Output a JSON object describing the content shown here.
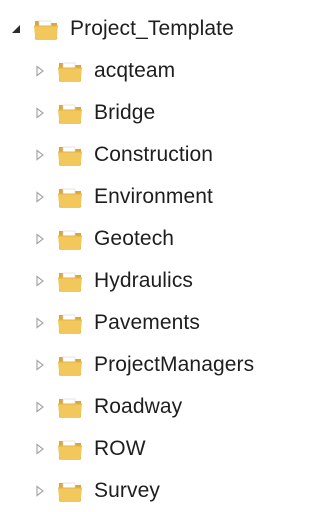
{
  "tree": {
    "root": {
      "label": "Project_Template",
      "expanded": true,
      "icon": "folder-icon",
      "expander_icon": "expanded-triangle-icon"
    },
    "children": [
      {
        "label": "acqteam",
        "expanded": false
      },
      {
        "label": "Bridge",
        "expanded": false
      },
      {
        "label": "Construction",
        "expanded": false
      },
      {
        "label": "Environment",
        "expanded": false
      },
      {
        "label": "Geotech",
        "expanded": false
      },
      {
        "label": "Hydraulics",
        "expanded": false
      },
      {
        "label": "Pavements",
        "expanded": false
      },
      {
        "label": "ProjectManagers",
        "expanded": false
      },
      {
        "label": "Roadway",
        "expanded": false
      },
      {
        "label": "ROW",
        "expanded": false
      },
      {
        "label": "Survey",
        "expanded": false
      }
    ],
    "child_icon": "folder-icon",
    "child_expander_icon": "collapsed-triangle-icon"
  },
  "colors": {
    "folder_front": "#f2c75c",
    "folder_back": "#d9a73a",
    "folder_paper": "#ffffff",
    "expander_collapsed": "#a6a6a6",
    "expander_expanded": "#2b2b2b",
    "text": "#1e1e1e"
  }
}
